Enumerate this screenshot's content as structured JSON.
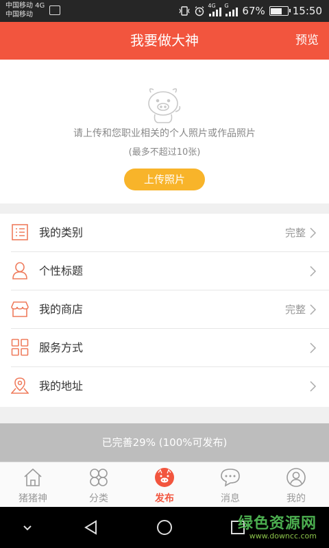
{
  "status_bar": {
    "carrier_line1": "中国移动 4G",
    "carrier_line2": "中国移动",
    "net_tag_1": "4G",
    "net_tag_2": "G",
    "battery_percent": "67%",
    "battery_level": 0.67,
    "time": "15:50"
  },
  "header": {
    "title": "我要做大神",
    "preview_label": "预览"
  },
  "upload": {
    "hint": "请上传和您职业相关的个人照片或作品照片",
    "limit": "(最多不超过10张)",
    "button_label": "上传照片"
  },
  "menu": {
    "items": [
      {
        "label": "我的类别",
        "status": "完整",
        "icon": "list-icon"
      },
      {
        "label": "个性标题",
        "status": "",
        "icon": "person-icon"
      },
      {
        "label": "我的商店",
        "status": "完整",
        "icon": "shop-icon"
      },
      {
        "label": "服务方式",
        "status": "",
        "icon": "grid-icon"
      },
      {
        "label": "我的地址",
        "status": "",
        "icon": "location-icon"
      }
    ]
  },
  "completion": {
    "text": "已完善29% (100%可发布)"
  },
  "tabs": [
    {
      "label": "猪猪神",
      "icon": "home-icon"
    },
    {
      "label": "分类",
      "icon": "category-icon"
    },
    {
      "label": "发布",
      "icon": "pig-face-icon",
      "active": true
    },
    {
      "label": "消息",
      "icon": "message-icon"
    },
    {
      "label": "我的",
      "icon": "profile-icon"
    }
  ],
  "watermark": {
    "logo_text": "绿色资源网",
    "url": "www.downcc.com"
  },
  "colors": {
    "accent": "#f2553e",
    "button": "#f8b42a",
    "icon_orange": "#ef7b5c"
  }
}
